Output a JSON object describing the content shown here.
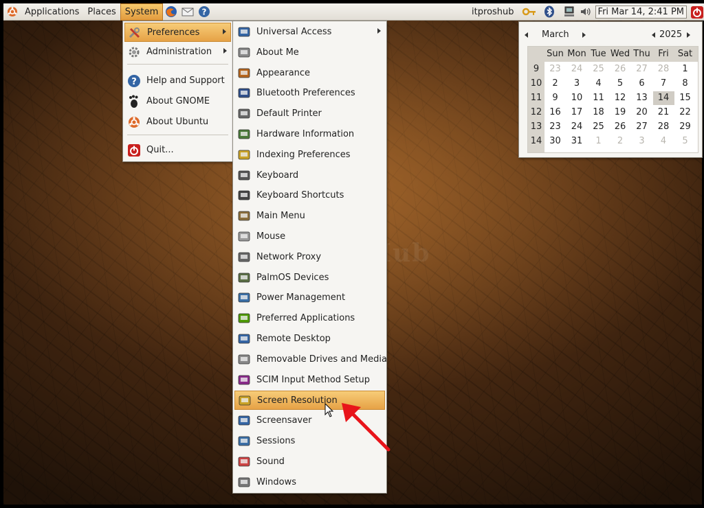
{
  "panel": {
    "menus": [
      "Applications",
      "Places",
      "System"
    ],
    "username": "itproshub",
    "clock": "Fri Mar 14,  2:41 PM",
    "tray_icons": [
      "firefox-icon",
      "mail-icon",
      "help-icon",
      "network-key-icon",
      "bluetooth-icon",
      "network-icon",
      "volume-icon",
      "power-icon"
    ]
  },
  "system_menu": {
    "items": [
      {
        "label": "Preferences",
        "icon": "preferences-icon",
        "submenu": true,
        "highlighted": true
      },
      {
        "label": "Administration",
        "icon": "administration-icon",
        "submenu": true
      },
      {
        "label": "Help and Support",
        "icon": "help-icon"
      },
      {
        "label": "About GNOME",
        "icon": "gnome-foot-icon"
      },
      {
        "label": "About Ubuntu",
        "icon": "ubuntu-icon"
      },
      {
        "label": "Quit...",
        "icon": "quit-icon"
      }
    ]
  },
  "preferences_menu": {
    "items": [
      {
        "label": "Universal Access",
        "icon": "accessibility-icon",
        "submenu": true
      },
      {
        "label": "About Me",
        "icon": "about-me-icon"
      },
      {
        "label": "Appearance",
        "icon": "appearance-icon"
      },
      {
        "label": "Bluetooth Preferences",
        "icon": "bluetooth-icon"
      },
      {
        "label": "Default Printer",
        "icon": "printer-icon"
      },
      {
        "label": "Hardware Information",
        "icon": "hardware-icon"
      },
      {
        "label": "Indexing Preferences",
        "icon": "indexing-icon"
      },
      {
        "label": "Keyboard",
        "icon": "keyboard-icon"
      },
      {
        "label": "Keyboard Shortcuts",
        "icon": "keyboard-shortcuts-icon"
      },
      {
        "label": "Main Menu",
        "icon": "main-menu-icon"
      },
      {
        "label": "Mouse",
        "icon": "mouse-icon"
      },
      {
        "label": "Network Proxy",
        "icon": "network-proxy-icon"
      },
      {
        "label": "PalmOS Devices",
        "icon": "palm-device-icon"
      },
      {
        "label": "Power Management",
        "icon": "power-management-icon"
      },
      {
        "label": "Preferred Applications",
        "icon": "preferred-apps-icon"
      },
      {
        "label": "Remote Desktop",
        "icon": "remote-desktop-icon"
      },
      {
        "label": "Removable Drives and Media",
        "icon": "removable-media-icon"
      },
      {
        "label": "SCIM Input Method Setup",
        "icon": "scim-icon"
      },
      {
        "label": "Screen Resolution",
        "icon": "screen-resolution-icon",
        "highlighted": true
      },
      {
        "label": "Screensaver",
        "icon": "screensaver-icon"
      },
      {
        "label": "Sessions",
        "icon": "sessions-icon"
      },
      {
        "label": "Sound",
        "icon": "sound-icon"
      },
      {
        "label": "Windows",
        "icon": "windows-icon"
      }
    ]
  },
  "calendar": {
    "month": "March",
    "year": "2025",
    "weekdays": [
      "Sun",
      "Mon",
      "Tue",
      "Wed",
      "Thu",
      "Fri",
      "Sat"
    ],
    "weeks": [
      {
        "week": "9",
        "days": [
          "23",
          "24",
          "25",
          "26",
          "27",
          "28",
          "1"
        ],
        "other": [
          true,
          true,
          true,
          true,
          true,
          true,
          false
        ]
      },
      {
        "week": "10",
        "days": [
          "2",
          "3",
          "4",
          "5",
          "6",
          "7",
          "8"
        ],
        "other": [
          false,
          false,
          false,
          false,
          false,
          false,
          false
        ]
      },
      {
        "week": "11",
        "days": [
          "9",
          "10",
          "11",
          "12",
          "13",
          "14",
          "15"
        ],
        "other": [
          false,
          false,
          false,
          false,
          false,
          false,
          false
        ]
      },
      {
        "week": "12",
        "days": [
          "16",
          "17",
          "18",
          "19",
          "20",
          "21",
          "22"
        ],
        "other": [
          false,
          false,
          false,
          false,
          false,
          false,
          false
        ]
      },
      {
        "week": "13",
        "days": [
          "23",
          "24",
          "25",
          "26",
          "27",
          "28",
          "29"
        ],
        "other": [
          false,
          false,
          false,
          false,
          false,
          false,
          false
        ]
      },
      {
        "week": "14",
        "days": [
          "30",
          "31",
          "1",
          "2",
          "3",
          "4",
          "5"
        ],
        "other": [
          false,
          false,
          true,
          true,
          true,
          true,
          true
        ]
      }
    ],
    "today": "14"
  },
  "watermark": "IT Pros Hub",
  "colors": {
    "highlight": "#e6a246",
    "annotation_arrow": "#e8141a"
  }
}
